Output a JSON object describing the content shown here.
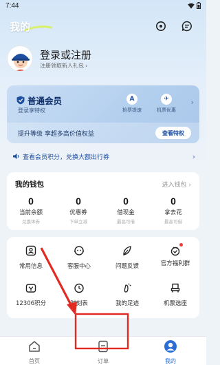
{
  "status_bar": {
    "time": "7:44"
  },
  "header": {
    "title": "我的",
    "icons": [
      "target-icon",
      "message-icon"
    ]
  },
  "user": {
    "login_title": "登录或注册",
    "login_sub": "注册领取新人礼包",
    "avatar": "avatar"
  },
  "vip": {
    "title": "普通会员",
    "sub": "登录享特权",
    "features": [
      {
        "icon": "rocket-icon",
        "glyph": "A",
        "label": "抢票提速"
      },
      {
        "icon": "airport-icon",
        "glyph": "✈",
        "label": "机票优惠"
      }
    ],
    "promo": "提升等级 享超多高价值权益",
    "button": "查看特权"
  },
  "points": {
    "text": "查看会员积分，兑换大额出行券"
  },
  "wallet": {
    "title": "我的钱包",
    "link": "进入钱包",
    "items": [
      {
        "value": "0",
        "label": "当前余额",
        "hint": "兑换体券"
      },
      {
        "value": "0",
        "label": "优惠券",
        "hint": "下单立减"
      },
      {
        "value": "0",
        "label": "借现金",
        "hint": "最高可借"
      },
      {
        "value": "0",
        "label": "拿去花",
        "hint": "最高可借"
      }
    ]
  },
  "services": {
    "items": [
      {
        "icon": "user-info-icon",
        "label": "常用信息"
      },
      {
        "icon": "customer-service-icon",
        "label": "客服中心"
      },
      {
        "icon": "feedback-icon",
        "label": "问题反馈"
      },
      {
        "icon": "welfare-group-icon",
        "label": "官方福利群"
      },
      {
        "icon": "points-icon",
        "label": "12306积分"
      },
      {
        "icon": "timetable-icon",
        "label": "时刻表"
      },
      {
        "icon": "footprint-icon",
        "label": "我的足迹"
      },
      {
        "icon": "seat-select-icon",
        "label": "机票选座"
      }
    ]
  },
  "tabbar": {
    "items": [
      {
        "icon": "home-icon",
        "label": "首页",
        "active": false
      },
      {
        "icon": "order-icon",
        "label": "订单",
        "active": false
      },
      {
        "icon": "profile-icon",
        "label": "我的",
        "active": true
      }
    ]
  },
  "colors": {
    "accent": "#2b6fd6",
    "vip_dark": "#0e2f6b",
    "annotation_red": "#e02a22"
  }
}
